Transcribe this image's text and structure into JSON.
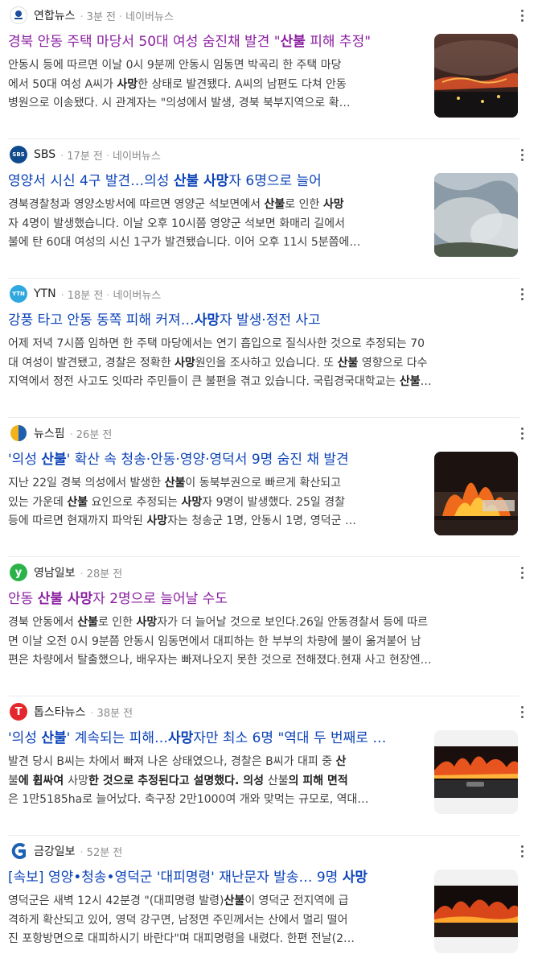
{
  "items": [
    {
      "press": "연합뉴스",
      "time": "3분 전",
      "source": "네이버뉴스",
      "title_parts": [
        "경북 안동 주택 마당서 50대 여성 숨진채 발견 \"",
        "산불",
        " 피해 추정\""
      ],
      "desc_lines": [
        "안동시 등에 따르면 이날 0시 9분께 안동시 임동면 박곡리 한 주택 마당",
        [
          "에서 50대 여성 A씨가 ",
          "사망",
          "한 상태로 발견됐다. A씨의 남편도 다쳐 안동"
        ],
        "병원으로 이송됐다. 시 관계자는 \"의성에서 발생, 경북 북부지역으로 확…"
      ],
      "logo_text": "연합"
    },
    {
      "press": "SBS",
      "time": "17분 전",
      "source": "네이버뉴스",
      "title_parts": [
        "영양서 시신 4구 발견…의성 ",
        "산불 사망",
        "자 6명으로 늘어"
      ],
      "desc_lines": [
        [
          "경북경찰청과 영양소방서에 따르면 영양군 석보면에서 ",
          "산불",
          "로 인한 ",
          "사망"
        ],
        "자 4명이 발생했습니다. 이날 오후 10시쯤 영양군 석보면 화매리 길에서",
        "불에 탄 60대 여성의 시신 1구가 발견됐습니다. 이어 오후 11시 5분쯤에…"
      ],
      "logo_text": "SBS"
    },
    {
      "press": "YTN",
      "time": "18분 전",
      "source": "네이버뉴스",
      "title_parts": [
        "강풍 타고 안동 동쪽 피해 커져…",
        "사망",
        "자 발생·정전 사고"
      ],
      "desc_lines": [
        "어제 저녁 7시쯤 임하면 한 주택 마당에서는 연기 흡입으로 질식사한 것으로 추정되는 70",
        [
          "대 여성이 발견됐고, 경찰은 정확한 ",
          "사망",
          "원인을 조사하고 있습니다. 또 ",
          "산불",
          " 영향으로 다수"
        ],
        [
          "지역에서 정전 사고도 잇따라 주민들이 큰 불편을 겪고 있습니다. 국립경국대학교는 ",
          "산불",
          "…"
        ]
      ],
      "logo_text": "YTN"
    },
    {
      "press": "뉴스핌",
      "time": "26분 전",
      "source": "",
      "title_parts": [
        "'의성 ",
        "산불",
        "' 확산 속 청송·안동·영양·영덕서 9명 숨진 채 발견"
      ],
      "desc_lines": [
        [
          "지난 22일 경북 의성에서 발생한 ",
          "산불",
          "이 동북부권으로 빠르게 확산되고"
        ],
        [
          "있는 가운데 ",
          "산불",
          " 요인으로 추정되는 ",
          "사망",
          "자 9명이 발생했다. 25일 경찰"
        ],
        [
          "등에 따르면 현재까지 파악된 ",
          "사망",
          "자는 청송군 1명, 안동시 1명, 영덕군 …"
        ]
      ],
      "logo_text": ""
    },
    {
      "press": "영남일보",
      "time": "28분 전",
      "source": "",
      "title_parts": [
        "안동 ",
        "산불 사망",
        "자 2명으로 늘어날 수도"
      ],
      "desc_lines": [
        [
          "경북 안동에서 ",
          "산불",
          "로 인한 ",
          "사망",
          "자가 더 늘어날 것으로 보인다.26일 안동경찰서 등에 따르"
        ],
        "면 이날 오전 0시 9분쯤 안동시 임동면에서 대피하는 한 부부의 차량에 불이 옮겨붙어 남",
        "편은 차량에서 탈출했으나, 배우자는 빠져나오지 못한 것으로 전해졌다.현재 사고 현장엔…"
      ],
      "logo_text": "y"
    },
    {
      "press": "톱스타뉴스",
      "time": "38분 전",
      "source": "",
      "title_parts": [
        "'의성 ",
        "산불",
        "' 계속되는 피해…",
        "사망",
        "자만 최소 6명 \"역대 두 번째로 …"
      ],
      "desc_lines": [
        [
          "발견 당시 B씨는 차에서 빠져 나온 상태였으나, 경찰은 B씨가 대피 중 ",
          "산"
        ],
        [
          "불",
          "에 휩싸여 ",
          "사망",
          "한 것으로 추정된다고 설명했다. 의성 ",
          "산불",
          "의 피해 면적"
        ],
        "은 1만5185ha로 늘어났다. 축구장 2만1000여 개와 맞먹는 규모로, 역대…"
      ],
      "logo_text": "T"
    },
    {
      "press": "금강일보",
      "time": "52분 전",
      "source": "",
      "title_parts": [
        "[속보] 영양•청송•영덕군 '대피명령' 재난문자 발송… 9명 ",
        "사망",
        ""
      ],
      "desc_lines": [
        [
          "영덕군은 새벽 12시 42분경 \"(대피명령 발령)",
          "산불",
          "이 영덕군 전지역에 급"
        ],
        "격하게 확산되고 있어, 영덕 강구면, 남정면 주민께서는 산에서 멀리 떨어",
        "진 포항방면으로 대피하시기 바란다\"며 대피명령을 내렸다. 한편 전날(2…"
      ],
      "logo_text": "G"
    }
  ],
  "colors": {
    "link": "#0c43b7",
    "visited": "#8a1ea0",
    "meta": "#8b8b8b"
  }
}
